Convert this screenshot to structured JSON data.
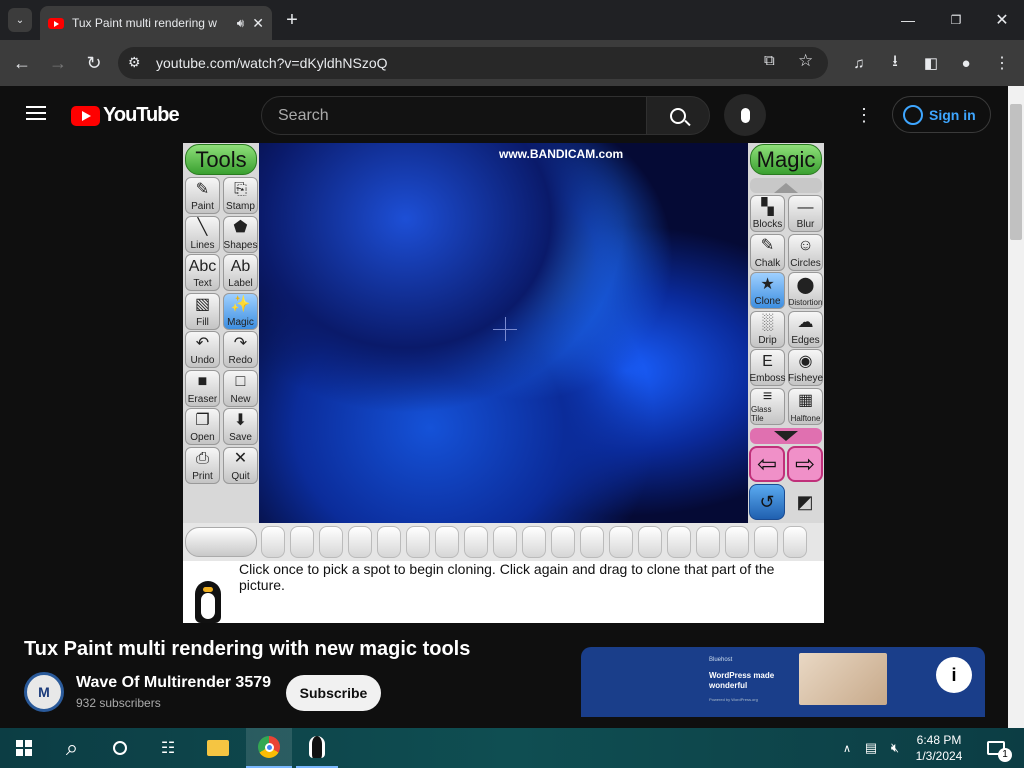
{
  "browser": {
    "tab_title": "Tux Paint multi rendering w",
    "url": "youtube.com/watch?v=dKyldhNSzoQ",
    "new_tab": "+"
  },
  "youtube": {
    "logo_text": "YouTube",
    "search_placeholder": "Search",
    "signin": "Sign in"
  },
  "video": {
    "watermark": "www.BANDICAM.com",
    "tools_header": "Tools",
    "magic_header": "Magic",
    "left_tools": [
      "Paint",
      "Stamp",
      "Lines",
      "Shapes",
      "Text",
      "Label",
      "Fill",
      "Magic",
      "Undo",
      "Redo",
      "Eraser",
      "New",
      "Open",
      "Save",
      "Print",
      "Quit"
    ],
    "magic_tools": [
      "Blocks",
      "Blur",
      "Chalk",
      "Circles",
      "Clone",
      "Distortion",
      "Drip",
      "Edges",
      "Emboss",
      "Fisheye",
      "Glass Tile",
      "Halftone"
    ],
    "tip": "Click once to pick a spot to begin cloning. Click again and drag to clone that part of the picture."
  },
  "info": {
    "title": "Tux Paint multi rendering with new magic tools",
    "channel": "Wave Of Multirender 3579",
    "subscribers": "932 subscribers",
    "subscribe": "Subscribe",
    "avatar_letter": "M"
  },
  "ad": {
    "brand": "Bluehost",
    "headline": "WordPress made wonderful",
    "sub": "Powered by WordPress.org"
  },
  "taskbar": {
    "time": "6:48 PM",
    "date": "1/3/2024",
    "notifications": "1"
  }
}
